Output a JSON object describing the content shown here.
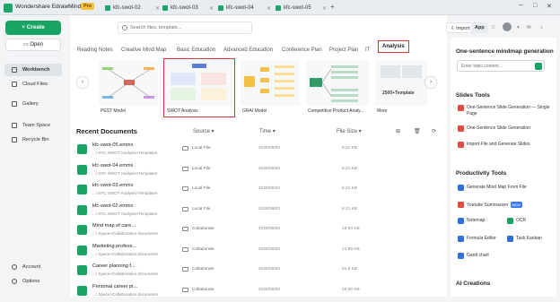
{
  "titlebar": {
    "app_name": "Wondershare EdrawMind",
    "pro_badge": "Pro",
    "tabs": [
      "kfc-swot-02",
      "kfc-swot-03",
      "kfc-swot-04",
      "kfc-swot-05"
    ],
    "new_tab": "+",
    "controls": [
      "─",
      "□",
      "✕"
    ]
  },
  "sidebar": {
    "create_label": "Create",
    "open_label": "Open",
    "items": [
      "Workbench",
      "Cloud Files",
      "Gallery",
      "Team Space",
      "Recycle Bin"
    ],
    "bottom_items": [
      "Account",
      "Options"
    ]
  },
  "toolbar": {
    "search_placeholder": "Search files, template...",
    "import_label": "Import",
    "app_label": "App"
  },
  "template_tabs": [
    "Reading Notes",
    "Creative Mind Map",
    "Basic Education",
    "Advanced Education",
    "Conference Plan",
    "Project Plan",
    "IT",
    "Analysis"
  ],
  "selected_tab": "Analysis",
  "template_cards": [
    {
      "label": "PEST Model"
    },
    {
      "label": "SWOT Analysis"
    },
    {
      "label": "GRAI Model"
    },
    {
      "label": "Competitive Product Analy..."
    },
    {
      "label": "More"
    }
  ],
  "more_card_text": "2500+Template",
  "recent": {
    "title": "Recent Documents",
    "columns": {
      "source": "Source",
      "time": "Time",
      "size": "File Size"
    },
    "rows": [
      {
        "name": "kfc-swot-05.emmx",
        "path": "...\\ KFC SWOT Analysis>Templates",
        "source": "Local File",
        "time": "2025/09/02",
        "size": "8.21 KB"
      },
      {
        "name": "kfc-swot-04.emmx",
        "path": "...\\ KFC SWOT Analysis>Templates",
        "source": "Local File",
        "time": "2025/09/02",
        "size": "8.21 KB"
      },
      {
        "name": "kfc-swot-03.emmx",
        "path": "...\\ KFC SWOT Analysis>Templates",
        "source": "Local File",
        "time": "2025/09/02",
        "size": "8.21 KB"
      },
      {
        "name": "kfc-swot-02.emmx",
        "path": "...\\ KFC SWOT Analysis>Templates",
        "source": "Local File",
        "time": "2025/09/02",
        "size": "8.21 KB"
      },
      {
        "name": "Mind map of care...",
        "path": "...\\ Space>Collaboration documents",
        "source": "Collaborate",
        "time": "2025/09/02",
        "size": "19.83 KB"
      },
      {
        "name": "Marketing profess...",
        "path": "...\\ Space>Collaboration documents",
        "source": "Collaborate",
        "time": "2025/09/02",
        "size": "14.89 KB"
      },
      {
        "name": "Career planning f...",
        "path": "...\\ Space>Collaboration documents",
        "source": "Collaborate",
        "time": "2025/09/02",
        "size": "24.8 KB"
      },
      {
        "name": "Personal career pl...",
        "path": "...\\ Space>Collaboration documents",
        "source": "Collaborate",
        "time": "2025/09/02",
        "size": "49.95 KB"
      }
    ]
  },
  "right_panel": {
    "section1_title": "One-sentence mindmap generation",
    "topic_placeholder": "Enter topic content...",
    "section2_title": "Slides Tools",
    "slides_items": [
      "One-Sentence Slide Generation — Single Page",
      "One-Sentence Slide Generation",
      "Import File and Generate Slides"
    ],
    "section3_title": "Productivity Tools",
    "productivity_items": [
      "Generate Mind Map From File",
      "Youtube Summarizer",
      "Notemap",
      "OCR",
      "Formula Editor",
      "Task Kanban",
      "Gantt chart"
    ],
    "youtube_badge": "NEW",
    "section4_title": "AI Creations"
  },
  "colors": {
    "accent": "#19a463",
    "highlight": "#d43b3b"
  }
}
